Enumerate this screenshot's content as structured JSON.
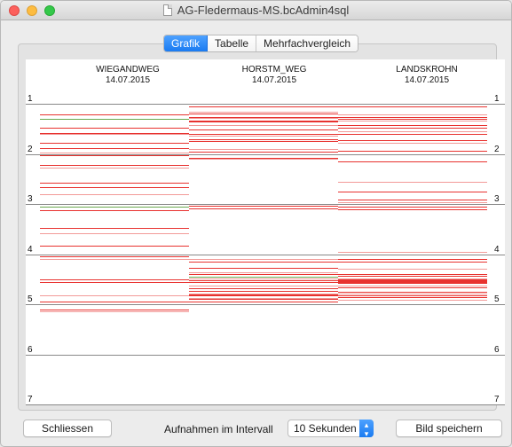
{
  "window": {
    "title": "AG-Fledermaus-MS.bcAdmin4sql"
  },
  "tabs": [
    {
      "label": "Grafik",
      "active": true
    },
    {
      "label": "Tabelle",
      "active": false
    },
    {
      "label": "Mehrfachvergleich",
      "active": false
    }
  ],
  "chart": {
    "stations": [
      {
        "name": "WIEGANDWEG",
        "date": "14.07.2015"
      },
      {
        "name": "HORSTM_WEG",
        "date": "14.07.2015"
      },
      {
        "name": "LANDSKROHN",
        "date": "14.07.2015"
      }
    ],
    "axis_labels": [
      "1",
      "2",
      "3",
      "4",
      "5",
      "6",
      "7"
    ],
    "colors": {
      "recording": "#e8322f",
      "recording_light": "#f29a98",
      "special": "#6aa84f"
    }
  },
  "chart_data": {
    "type": "table",
    "y_axis": {
      "ticks": [
        1,
        2,
        3,
        4,
        5,
        6,
        7
      ],
      "range": [
        1,
        7
      ]
    },
    "series": [
      {
        "name": "WIEGANDWEG",
        "recordings": [
          1.22,
          1.3,
          1.48,
          1.58,
          1.6,
          1.77,
          1.88,
          1.98,
          2.02,
          2.22,
          2.28,
          2.58,
          2.67,
          2.81,
          3.13,
          3.47,
          3.58,
          3.83,
          4.05,
          4.1,
          4.5,
          4.55,
          4.83,
          4.95,
          5.11,
          5.15
        ]
      },
      {
        "name": "HORSTM_WEG",
        "recordings": [
          1.05,
          1.16,
          1.2,
          1.26,
          1.28,
          1.33,
          1.36,
          1.42,
          1.52,
          1.6,
          1.64,
          1.7,
          1.74,
          1.9,
          1.96,
          2.08,
          2.1,
          3.04,
          3.08,
          4.1,
          4.15,
          4.28,
          4.36,
          4.4,
          4.45,
          4.48,
          4.52,
          4.55,
          4.62,
          4.68,
          4.73,
          4.78,
          4.8,
          4.83,
          4.87,
          4.9,
          4.94
        ]
      },
      {
        "name": "LANDSKROHN",
        "recordings": [
          1.05,
          1.22,
          1.26,
          1.3,
          1.34,
          1.42,
          1.48,
          1.55,
          1.6,
          1.72,
          1.78,
          1.93,
          2.15,
          2.56,
          2.75,
          2.92,
          2.96,
          3.06,
          3.1,
          3.95,
          4.1,
          4.15,
          4.3,
          4.4,
          4.44,
          4.48,
          4.52,
          4.58,
          4.62,
          4.66,
          4.75,
          4.78,
          4.82,
          4.86,
          4.92
        ]
      }
    ]
  },
  "footer": {
    "close_label": "Schliessen",
    "interval_label": "Aufnahmen im Intervall",
    "interval_value": "10 Sekunden",
    "save_label": "Bild speichern"
  }
}
